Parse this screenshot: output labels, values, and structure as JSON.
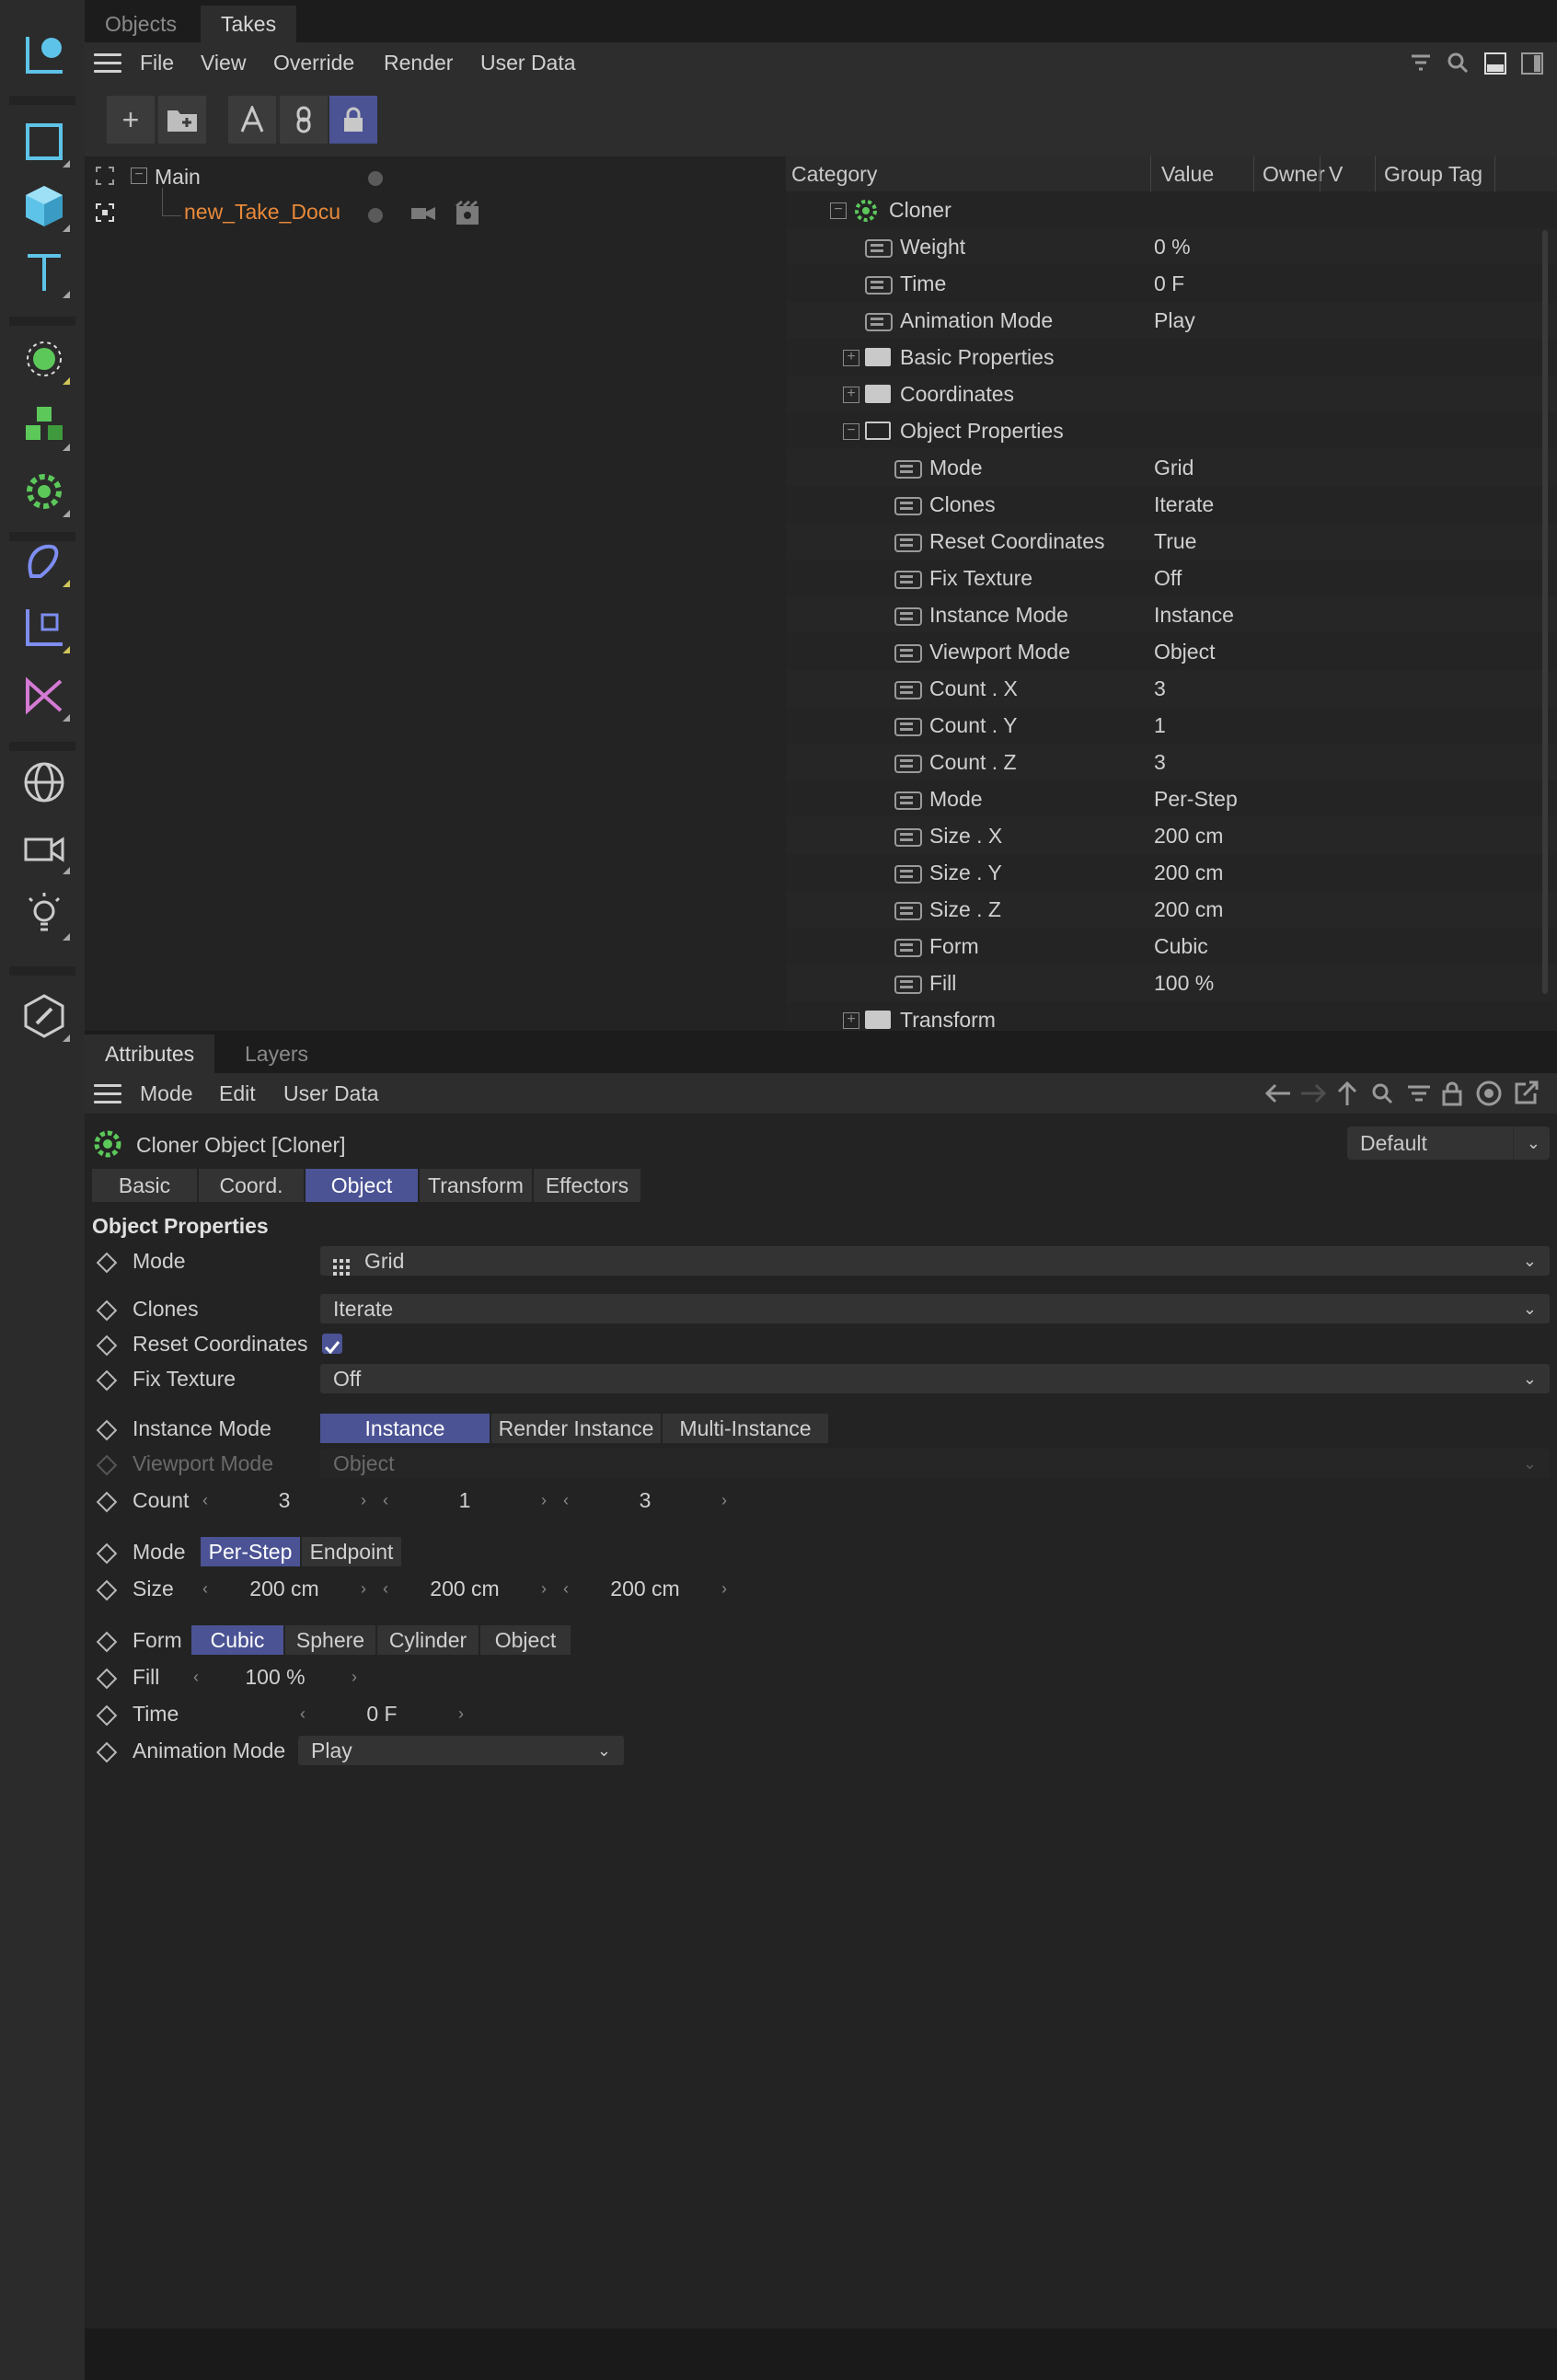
{
  "toolbar": {
    "tools": [
      "frame-selection-icon",
      "rectangle-icon",
      "cube-icon",
      "text-icon",
      "cloner-active-icon",
      "cluster-icon",
      "cloner-icon",
      "spline-pen-icon",
      "subdivision-icon",
      "deformer-icon",
      "globe-icon",
      "camera-icon",
      "light-icon",
      "edit-icon"
    ]
  },
  "takes": {
    "tabs": [
      "Objects",
      "Takes"
    ],
    "active_tab": "Takes",
    "menu": [
      "File",
      "View",
      "Override",
      "Render",
      "User Data"
    ],
    "tree": [
      {
        "label": "Main"
      },
      {
        "label": "new_Take_Docu",
        "color": "#e8893a"
      }
    ],
    "columns": {
      "category": "Category",
      "value": "Value",
      "owner": "Owner",
      "v": "V",
      "group_tag": "Group Tag"
    },
    "rows": [
      {
        "label": "Cloner",
        "value": "",
        "type": "object",
        "indent": 0
      },
      {
        "label": "Weight",
        "value": "0 %",
        "type": "param",
        "indent": 1
      },
      {
        "label": "Time",
        "value": "0 F",
        "type": "param",
        "indent": 1
      },
      {
        "label": "Animation Mode",
        "value": "Play",
        "type": "param",
        "indent": 1
      },
      {
        "label": "Basic Properties",
        "value": "",
        "type": "folder",
        "indent": 1
      },
      {
        "label": "Coordinates",
        "value": "",
        "type": "folder",
        "indent": 1
      },
      {
        "label": "Object Properties",
        "value": "",
        "type": "folder-open",
        "indent": 1
      },
      {
        "label": "Mode",
        "value": "Grid",
        "type": "param",
        "indent": 2
      },
      {
        "label": "Clones",
        "value": "Iterate",
        "type": "param",
        "indent": 2
      },
      {
        "label": "Reset Coordinates",
        "value": "True",
        "type": "param",
        "indent": 2
      },
      {
        "label": "Fix Texture",
        "value": "Off",
        "type": "param",
        "indent": 2
      },
      {
        "label": "Instance Mode",
        "value": "Instance",
        "type": "param",
        "indent": 2
      },
      {
        "label": "Viewport Mode",
        "value": "Object",
        "type": "param",
        "indent": 2
      },
      {
        "label": "Count . X",
        "value": "3",
        "type": "param",
        "indent": 2
      },
      {
        "label": "Count . Y",
        "value": "1",
        "type": "param",
        "indent": 2
      },
      {
        "label": "Count . Z",
        "value": "3",
        "type": "param",
        "indent": 2
      },
      {
        "label": "Mode",
        "value": "Per-Step",
        "type": "param",
        "indent": 2
      },
      {
        "label": "Size . X",
        "value": "200 cm",
        "type": "param",
        "indent": 2
      },
      {
        "label": "Size . Y",
        "value": "200 cm",
        "type": "param",
        "indent": 2
      },
      {
        "label": "Size . Z",
        "value": "200 cm",
        "type": "param",
        "indent": 2
      },
      {
        "label": "Form",
        "value": "Cubic",
        "type": "param",
        "indent": 2
      },
      {
        "label": "Fill",
        "value": "100 %",
        "type": "param",
        "indent": 2
      },
      {
        "label": "Transform",
        "value": "",
        "type": "folder",
        "indent": 1
      }
    ]
  },
  "attributes": {
    "tabs": [
      "Attributes",
      "Layers"
    ],
    "active_tab": "Attributes",
    "menu": [
      "Mode",
      "Edit",
      "User Data"
    ],
    "object_title": "Cloner Object [Cloner]",
    "preset": "Default",
    "subtabs": [
      "Basic",
      "Coord.",
      "Object",
      "Transform",
      "Effectors"
    ],
    "active_subtab": "Object",
    "section_title": "Object Properties",
    "fields": {
      "mode": {
        "label": "Mode",
        "value": "Grid"
      },
      "clones": {
        "label": "Clones",
        "value": "Iterate"
      },
      "reset_coordinates": {
        "label": "Reset Coordinates",
        "checked": true
      },
      "fix_texture": {
        "label": "Fix Texture",
        "value": "Off"
      },
      "instance_mode": {
        "label": "Instance Mode",
        "options": [
          "Instance",
          "Render Instance",
          "Multi-Instance"
        ],
        "selected": "Instance"
      },
      "viewport_mode": {
        "label": "Viewport Mode",
        "value": "Object"
      },
      "count": {
        "label": "Count",
        "values": [
          "3",
          "1",
          "3"
        ]
      },
      "size_mode": {
        "label": "Mode",
        "options": [
          "Per-Step",
          "Endpoint"
        ],
        "selected": "Per-Step"
      },
      "size": {
        "label": "Size",
        "values": [
          "200 cm",
          "200 cm",
          "200 cm"
        ]
      },
      "form": {
        "label": "Form",
        "options": [
          "Cubic",
          "Sphere",
          "Cylinder",
          "Object"
        ],
        "selected": "Cubic"
      },
      "fill": {
        "label": "Fill",
        "value": "100 %"
      },
      "time": {
        "label": "Time",
        "value": "0 F"
      },
      "animation_mode": {
        "label": "Animation Mode",
        "value": "Play"
      }
    }
  },
  "colors": {
    "accent": "#4b5394",
    "take_name": "#e8893a",
    "cloner_icon": "#5cc85a"
  }
}
